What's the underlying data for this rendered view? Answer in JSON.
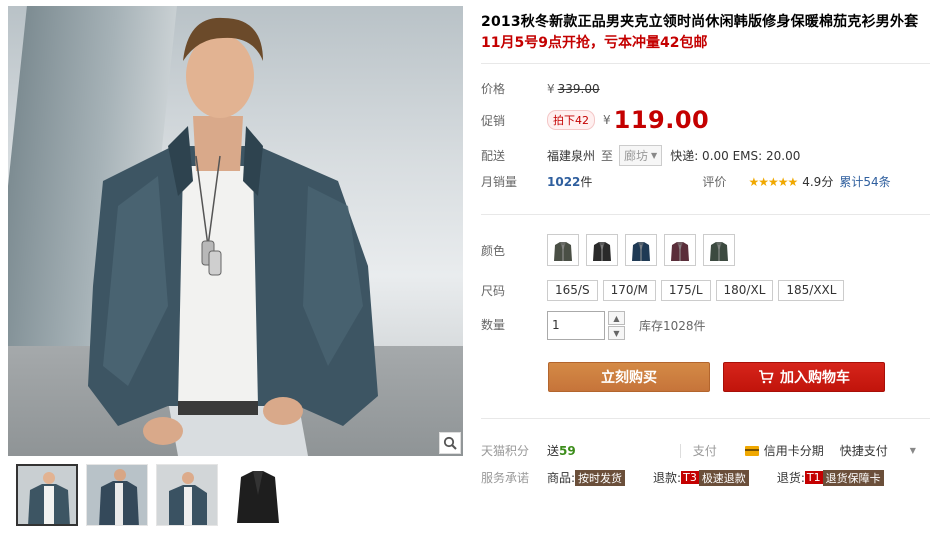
{
  "product": {
    "title": "2013秋冬新款正品男夹克立领时尚休闲韩版修身保暖棉茄克衫男外套",
    "subtitle": "11月5号9点开抢，亏本冲量42包邮"
  },
  "price": {
    "label": "价格",
    "currency": "¥",
    "original": "339.00"
  },
  "promo": {
    "label": "促销",
    "tag": "拍下42",
    "currency": "¥",
    "price": "119.00"
  },
  "shipping": {
    "label": "配送",
    "from": "福建泉州",
    "to_word": "至",
    "destination": "廊坊",
    "fees": "快递: 0.00 EMS: 20.00"
  },
  "sales": {
    "label": "月销量",
    "count": "1022",
    "unit": "件",
    "rating_label": "评价",
    "stars": "★★★★★",
    "score": "4.9分",
    "total_reviews": "累计54条"
  },
  "color": {
    "label": "颜色",
    "swatches": [
      "#4a4f45",
      "#2a2a2a",
      "#1f3a55",
      "#5a2e3a",
      "#3c4a40"
    ]
  },
  "size": {
    "label": "尺码",
    "options": [
      "165/S",
      "170/M",
      "175/L",
      "180/XL",
      "185/XXL"
    ]
  },
  "quantity": {
    "label": "数量",
    "value": "1",
    "stock": "库存1028件"
  },
  "actions": {
    "buy_now": "立刻购买",
    "add_to_cart": "加入购物车"
  },
  "points": {
    "label": "天猫积分",
    "send_word": "送",
    "amount": "59",
    "pay_label": "支付",
    "credit_card": "信用卡分期",
    "quick_pay": "快捷支付"
  },
  "service": {
    "label": "服务承诺",
    "goods_label": "商品:",
    "goods_tag": "按时发货",
    "refund_label": "退款:",
    "refund_code": "T3",
    "refund_tag": "极速退款",
    "return_label": "退货:",
    "return_code": "T1",
    "return_tag": "退货保障卡"
  },
  "icons": {
    "zoom": "magnifier-icon",
    "cart": "cart-icon",
    "dropdown": "triangle-down-icon",
    "card": "credit-card-icon"
  }
}
